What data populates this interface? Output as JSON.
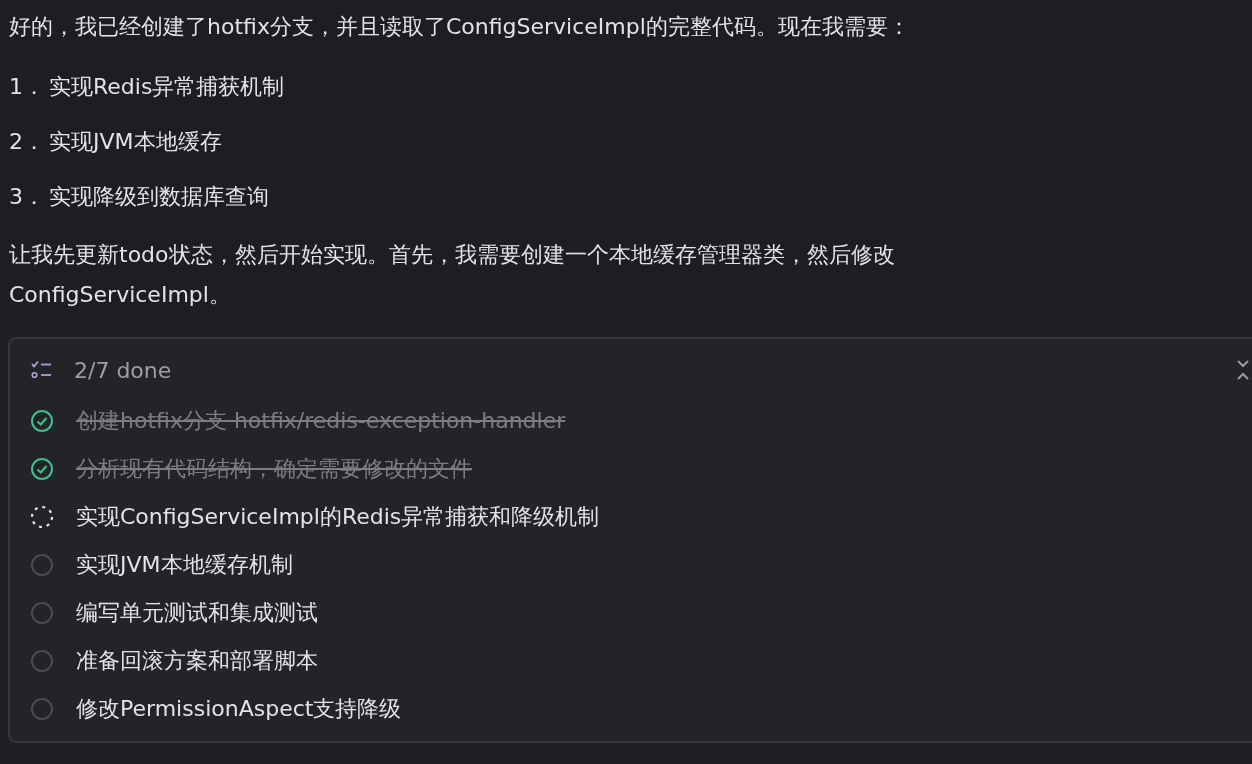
{
  "intro": "好的，我已经创建了hotfix分支，并且读取了ConfigServiceImpl的完整代码。现在我需要：",
  "steps": [
    {
      "number": "1．",
      "text": "实现Redis异常捕获机制"
    },
    {
      "number": "2．",
      "text": "实现JVM本地缓存"
    },
    {
      "number": "3．",
      "text": "实现降级到数据库查询"
    }
  ],
  "paragraph": "让我先更新todo状态，然后开始实现。首先，我需要创建一个本地缓存管理器类，然后修改ConfigServiceImpl。",
  "todo_panel": {
    "summary": "2/7 done",
    "expanded": true,
    "items": [
      {
        "text": "创建hotfix分支 hotfix/redis-exception-handler",
        "kind": "done"
      },
      {
        "text": "分析现有代码结构，确定需要修改的文件",
        "kind": "done"
      },
      {
        "text": "实现ConfigServiceImpl的Redis异常捕获和降级机制",
        "kind": "active"
      },
      {
        "text": "实现JVM本地缓存机制",
        "kind": "pending"
      },
      {
        "text": "编写单元测试和集成测试",
        "kind": "pending"
      },
      {
        "text": "准备回滚方案和部署脚本",
        "kind": "pending"
      },
      {
        "text": "修改PermissionAspect支持降级",
        "kind": "pending"
      }
    ]
  }
}
